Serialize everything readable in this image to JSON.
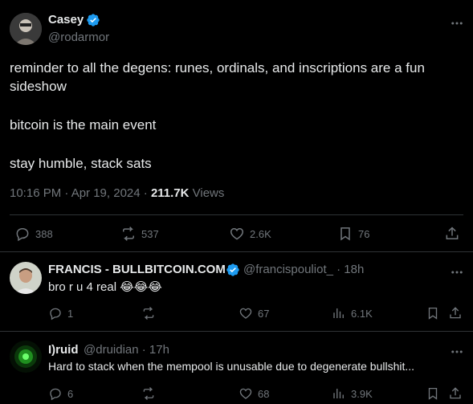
{
  "tweet": {
    "author_name": "Casey",
    "author_handle": "@rodarmor",
    "line1": "reminder to all the degens: runes, ordinals, and inscriptions are a fun",
    "line2": "sideshow",
    "line3": "bitcoin is the main event",
    "line4": "stay humble, stack sats",
    "time": "10:16 PM · Apr 19, 2024 · ",
    "views_count": "211.7K",
    "views_label": " Views",
    "replies": "388",
    "reposts": "537",
    "likes": "2.6K",
    "bookmarks": "76"
  },
  "replies": [
    {
      "name": "FRANCIS - BULLBITCOIN.COM",
      "handle": "@francispouliot_ · 18h",
      "text": "bro r u 4 real 😂😂😂",
      "replies": "1",
      "reposts": "",
      "likes": "67",
      "views": "6.1K"
    },
    {
      "name": "I)ruid",
      "handle": "@druidian · 17h",
      "text": "Hard to stack when the mempool is unusable due to degenerate bullshit...",
      "replies": "6",
      "reposts": "",
      "likes": "68",
      "views": "3.9K"
    }
  ],
  "colors": {
    "background": "#000000",
    "text": "#e7e9ea",
    "muted": "#71767b",
    "verified": "#1d9bf0",
    "divider": "#2f3336"
  }
}
